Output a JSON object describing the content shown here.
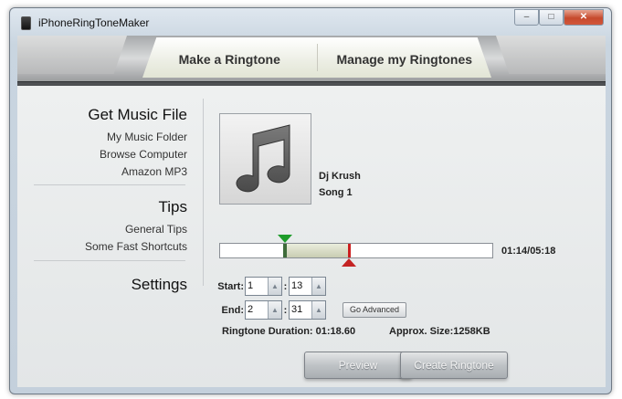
{
  "window": {
    "title": "iPhoneRingToneMaker",
    "minimize_glyph": "–",
    "maximize_glyph": "□",
    "close_glyph": "✕"
  },
  "tabs": [
    {
      "label": "Make a Ringtone",
      "active": true
    },
    {
      "label": "Manage my Ringtones",
      "active": false
    }
  ],
  "sidebar": {
    "get_music": {
      "heading": "Get Music File",
      "links": [
        "My Music Folder",
        "Browse Computer",
        "Amazon MP3"
      ]
    },
    "tips": {
      "heading": "Tips",
      "links": [
        "General Tips",
        "Some Fast Shortcuts"
      ]
    },
    "settings": {
      "heading": "Settings"
    }
  },
  "song": {
    "artist": "Dj Krush",
    "title": "Song 1",
    "artwork_icon": "music-note-icon"
  },
  "timeline": {
    "readout": "01:14/05:18",
    "start_fraction": 0.233,
    "end_fraction": 0.473
  },
  "start": {
    "label": "Start:",
    "minutes": "1",
    "seconds": "13"
  },
  "end": {
    "label": "End:",
    "minutes": "2",
    "seconds": "31"
  },
  "colon": ":",
  "spin_up_glyph": "▲",
  "go_advanced_label": "Go Advanced",
  "ringtone_duration": "Ringtone Duration:  01:18.60",
  "approx_size": "Approx. Size:1258KB",
  "preview_label": "Preview",
  "create_label": "Create Ringtone",
  "colors": {
    "start_marker": "#1e9c2a",
    "end_marker": "#c42323",
    "selection": "#c8ccb2"
  }
}
